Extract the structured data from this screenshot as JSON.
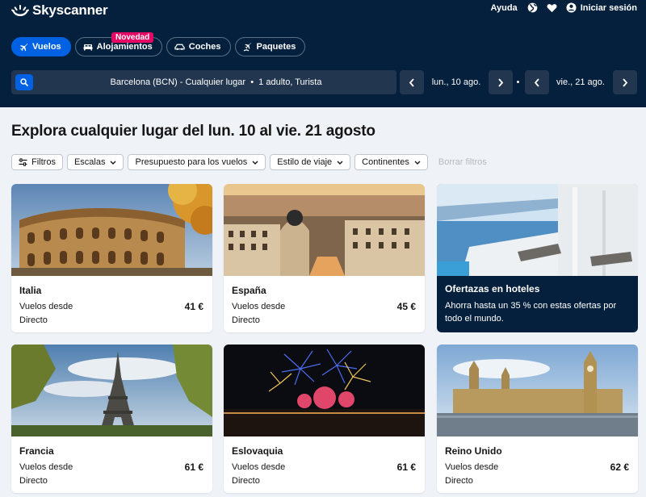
{
  "header": {
    "logo_text": "Skyscanner",
    "help": "Ayuda",
    "login": "Iniciar sesión"
  },
  "tabs": [
    {
      "label": "Vuelos",
      "active": true
    },
    {
      "label": "Alojamientos",
      "active": false
    },
    {
      "label": "Coches",
      "active": false
    },
    {
      "label": "Paquetes",
      "active": false
    }
  ],
  "badge": "Novedad",
  "search": {
    "origin": "Barcelona (BCN) - Cualquier lugar",
    "separator": "•",
    "passengers": "1 adulto, Turista"
  },
  "dates": {
    "depart": "lun., 10 ago.",
    "return": "vie., 21 ago."
  },
  "main": {
    "title": "Explora cualquier lugar del lun. 10 al vie. 21 agosto"
  },
  "filters": {
    "filtros": "Filtros",
    "escalas": "Escalas",
    "presupuesto": "Presupuesto para los vuelos",
    "estilo": "Estilo de viaje",
    "continentes": "Continentes",
    "borrar": "Borrar filtros"
  },
  "cards": [
    {
      "name": "Italia",
      "from": "Vuelos desde",
      "price": "41 €",
      "direct": "Directo"
    },
    {
      "name": "España",
      "from": "Vuelos desde",
      "price": "45 €",
      "direct": "Directo"
    },
    {
      "name": "Francia",
      "from": "Vuelos desde",
      "price": "61 €",
      "direct": "Directo"
    },
    {
      "name": "Eslovaquia",
      "from": "Vuelos desde",
      "price": "61 €",
      "direct": "Directo"
    },
    {
      "name": "Reino Unido",
      "from": "Vuelos desde",
      "price": "62 €",
      "direct": "Directo"
    }
  ],
  "promo": {
    "title": "Ofertazas en hoteles",
    "text": "Ahorra hasta un 35 % con estas ofertas por todo el mundo."
  },
  "colors": {
    "header_bg": "#05203c",
    "accent_blue": "#0062e3",
    "badge_pink": "#e70866",
    "page_bg": "#eff3f8"
  },
  "icons": [
    "skyscanner-logo-icon",
    "globe-icon",
    "heart-icon",
    "user-icon",
    "plane-icon",
    "bed-icon",
    "car-icon",
    "package-icon",
    "search-icon",
    "chevron-left-icon",
    "chevron-right-icon",
    "filter-sliders-icon",
    "chevron-down-icon"
  ]
}
